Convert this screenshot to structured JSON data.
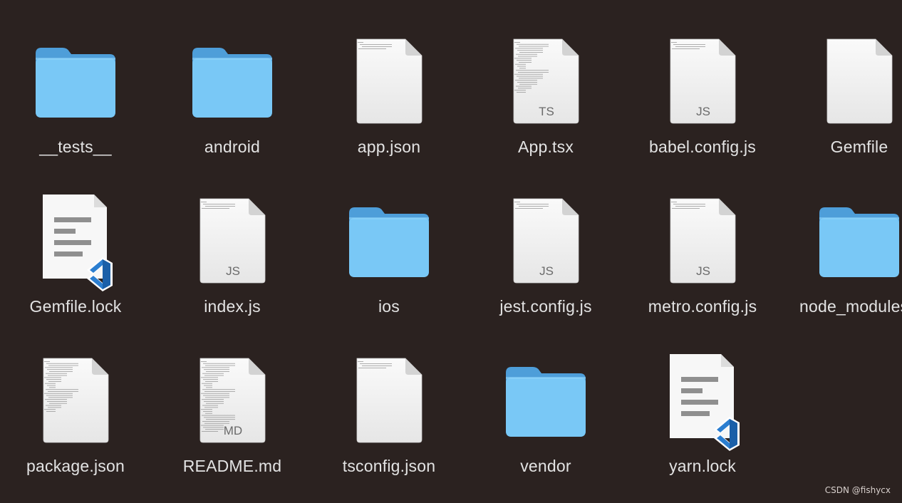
{
  "items": [
    {
      "name": "__tests__",
      "kind": "folder"
    },
    {
      "name": "android",
      "kind": "folder"
    },
    {
      "name": "app.json",
      "kind": "doc",
      "badge": "",
      "lines": "few"
    },
    {
      "name": "App.tsx",
      "kind": "doc",
      "badge": "TS",
      "lines": "many"
    },
    {
      "name": "babel.config.js",
      "kind": "doc",
      "badge": "JS",
      "lines": "few"
    },
    {
      "name": "Gemfile",
      "kind": "doc",
      "badge": "",
      "lines": "none"
    },
    {
      "name": "Gemfile.lock",
      "kind": "vscode"
    },
    {
      "name": "index.js",
      "kind": "doc",
      "badge": "JS",
      "lines": "few"
    },
    {
      "name": "ios",
      "kind": "folder"
    },
    {
      "name": "jest.config.js",
      "kind": "doc",
      "badge": "JS",
      "lines": "few"
    },
    {
      "name": "metro.config.js",
      "kind": "doc",
      "badge": "JS",
      "lines": "few"
    },
    {
      "name": "node_modules",
      "kind": "folder"
    },
    {
      "name": "package.json",
      "kind": "doc",
      "badge": "",
      "lines": "many"
    },
    {
      "name": "README.md",
      "kind": "doc",
      "badge": "MD",
      "lines": "dense"
    },
    {
      "name": "tsconfig.json",
      "kind": "doc",
      "badge": "",
      "lines": "few"
    },
    {
      "name": "vendor",
      "kind": "folder"
    },
    {
      "name": "yarn.lock",
      "kind": "vscode"
    }
  ],
  "colors": {
    "background": "#2b2220",
    "folder_front": "#79c8f6",
    "folder_back": "#4e9ed9",
    "label": "#e3e3e3",
    "vscode_blue": "#2b7ed0"
  },
  "watermark": "CSDN @fishycx"
}
